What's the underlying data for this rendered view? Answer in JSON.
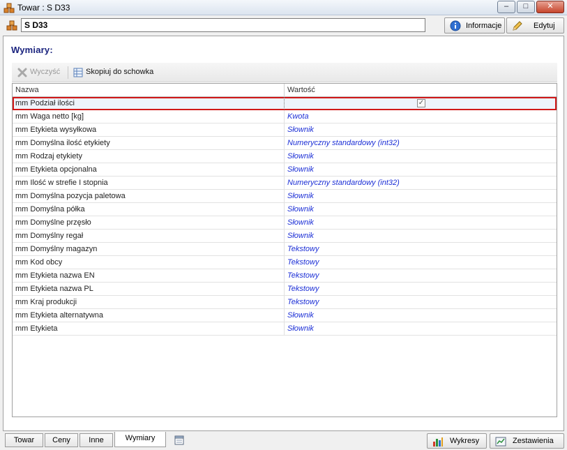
{
  "window": {
    "title": "Towar : S D33",
    "minimize": "–",
    "maximize": "□",
    "close": "✕"
  },
  "header": {
    "item_name": "S D33",
    "info_label": "Informacje",
    "edit_label": "Edytuj"
  },
  "section": {
    "title": "Wymiary:"
  },
  "toolbar": {
    "clear_label": "Wyczyść",
    "copy_label": "Skopiuj do schowka"
  },
  "grid": {
    "columns": [
      "Nazwa",
      "Wartość"
    ],
    "rows": [
      {
        "name": "mm Podział ilości",
        "value": "",
        "checkbox": true,
        "checked": true
      },
      {
        "name": "mm Waga netto [kg]",
        "value": "Kwota"
      },
      {
        "name": "mm Etykieta wysyłkowa",
        "value": "Słownik"
      },
      {
        "name": "mm Domyślna ilość etykiety",
        "value": "Numeryczny standardowy (int32)"
      },
      {
        "name": "mm Rodzaj etykiety",
        "value": "Słownik"
      },
      {
        "name": "mm Etykieta opcjonalna",
        "value": "Słownik"
      },
      {
        "name": "mm Ilość w strefie I stopnia",
        "value": "Numeryczny standardowy (int32)"
      },
      {
        "name": "mm Domyślna pozycja paletowa",
        "value": "Słownik"
      },
      {
        "name": "mm Domyślna półka",
        "value": "Słownik"
      },
      {
        "name": "mm Domyślne przęsło",
        "value": "Słownik"
      },
      {
        "name": "mm Domyślny regał",
        "value": "Słownik"
      },
      {
        "name": "mm Domyślny magazyn",
        "value": "Tekstowy"
      },
      {
        "name": "mm Kod obcy",
        "value": "Tekstowy"
      },
      {
        "name": "mm Etykieta nazwa EN",
        "value": "Tekstowy"
      },
      {
        "name": "mm Etykieta nazwa PL",
        "value": "Tekstowy"
      },
      {
        "name": "mm Kraj produkcji",
        "value": "Tekstowy"
      },
      {
        "name": "mm Etykieta alternatywna",
        "value": "Słownik"
      },
      {
        "name": "mm Etykieta",
        "value": "Słownik"
      }
    ]
  },
  "tabs": {
    "items": [
      "Towar",
      "Ceny",
      "Inne",
      "Wymiary"
    ],
    "active": "Wymiary",
    "charts_label": "Wykresy",
    "reports_label": "Zestawienia"
  },
  "colors": {
    "value_text": "#1c2fd6",
    "section_title": "#1a237e",
    "selection_outline": "#d01818"
  }
}
